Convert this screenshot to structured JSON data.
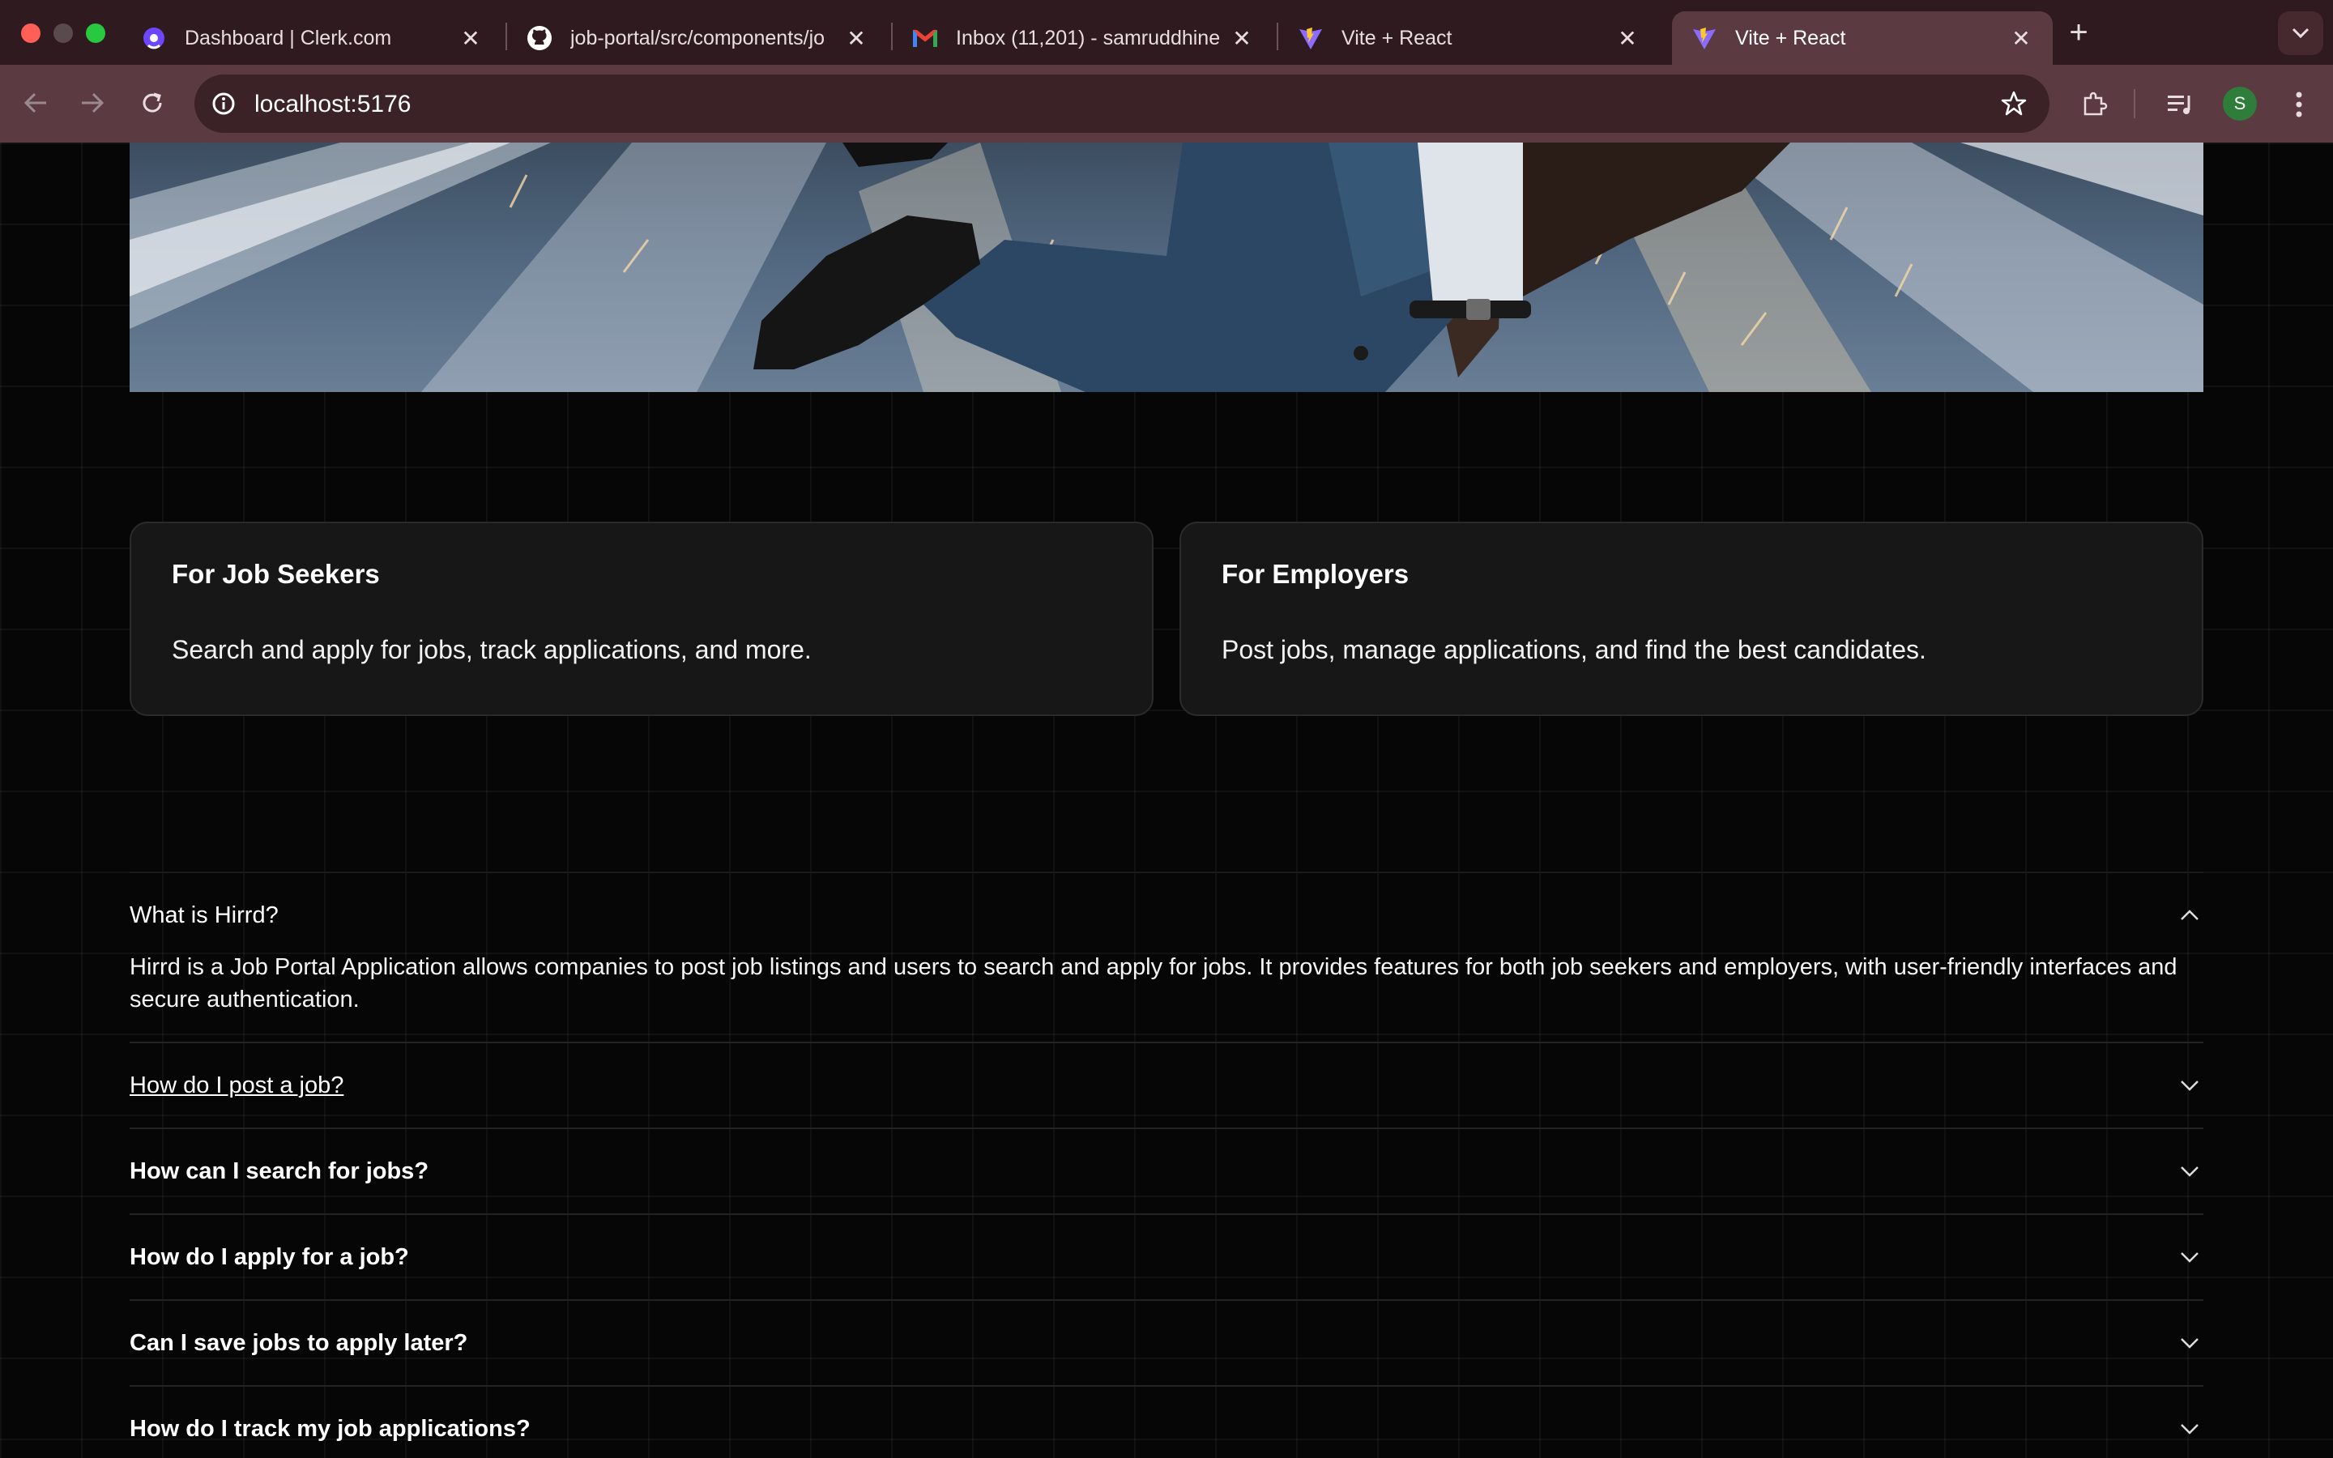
{
  "browser": {
    "tabs": [
      {
        "title": "Dashboard | Clerk.com",
        "icon": "clerk-icon"
      },
      {
        "title": "job-portal/src/components/jo",
        "icon": "github-icon"
      },
      {
        "title": "Inbox (11,201) - samruddhine",
        "icon": "gmail-icon"
      },
      {
        "title": "Vite + React",
        "icon": "vite-icon"
      },
      {
        "title": "Vite + React",
        "icon": "vite-icon",
        "active": true
      }
    ],
    "url": "localhost:5176",
    "profile_initial": "S"
  },
  "cards": [
    {
      "title": "For Job Seekers",
      "text": "Search and apply for jobs, track applications, and more."
    },
    {
      "title": "For Employers",
      "text": "Post jobs, manage applications, and find the best candidates."
    }
  ],
  "faq": [
    {
      "question": "What is Hirrd?",
      "answer": "Hirrd is a Job Portal Application allows companies to post job listings and users to search and apply for jobs. It provides features for both job seekers and employers, with user-friendly interfaces and secure authentication.",
      "open": true
    },
    {
      "question": "How do I post a job?"
    },
    {
      "question": "How can I search for jobs?"
    },
    {
      "question": "How do I apply for a job?"
    },
    {
      "question": "Can I save jobs to apply later?"
    },
    {
      "question": "How do I track my job applications?"
    }
  ]
}
